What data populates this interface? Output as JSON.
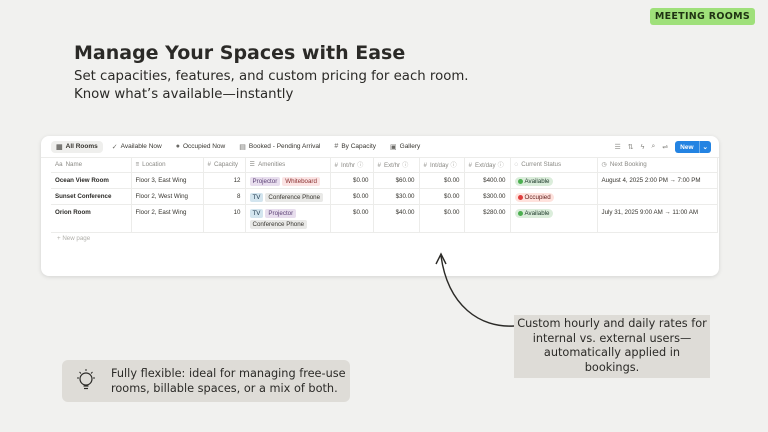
{
  "badge": "MEETING ROOMS",
  "headline": "Manage Your Spaces with Ease",
  "subline1": "Set capacities, features, and custom pricing for each room.",
  "subline2": "Know what’s available—instantly",
  "views": [
    {
      "icon": "table-icon",
      "glyph": "▦",
      "label": "All Rooms"
    },
    {
      "icon": "check-icon",
      "glyph": "✓",
      "label": "Available Now"
    },
    {
      "icon": "circle-icon",
      "glyph": "●",
      "label": "Occupied Now"
    },
    {
      "icon": "calendar-icon",
      "glyph": "▤",
      "label": "Booked - Pending Arrival"
    },
    {
      "icon": "hash-icon",
      "glyph": "#",
      "label": "By Capacity"
    },
    {
      "icon": "gallery-icon",
      "glyph": "▣",
      "label": "Gallery"
    }
  ],
  "toolbar": {
    "new_label": "New"
  },
  "columns": [
    {
      "glyph": "Aa",
      "label": "Name",
      "info": false
    },
    {
      "glyph": "≡",
      "label": "Location",
      "info": false
    },
    {
      "glyph": "#",
      "label": "Capacity",
      "info": false
    },
    {
      "glyph": "☰",
      "label": "Amenities",
      "info": false
    },
    {
      "glyph": "#",
      "label": "Int/hr",
      "info": true
    },
    {
      "glyph": "#",
      "label": "Ext/hr",
      "info": true
    },
    {
      "glyph": "#",
      "label": "Int/day",
      "info": true
    },
    {
      "glyph": "#",
      "label": "Ext/day",
      "info": true
    },
    {
      "glyph": "◌",
      "label": "Current Status",
      "info": false
    },
    {
      "glyph": "◷",
      "label": "Next Booking",
      "info": false
    }
  ],
  "rows": [
    {
      "name": "Ocean View Room",
      "location": "Floor 3, East Wing",
      "capacity": "12",
      "amenities": [
        {
          "label": "Projector",
          "bg": "#e8deee",
          "fg": "#5a3e74"
        },
        {
          "label": "Whiteboard",
          "bg": "#fbe4e4",
          "fg": "#8a2e2e"
        }
      ],
      "int_hr": "$0.00",
      "ext_hr": "$60.00",
      "int_day": "$0.00",
      "ext_day": "$400.00",
      "status": {
        "label": "Available",
        "dot": "#4caf50",
        "bg": "#dbeddb",
        "fg": "#1c3829"
      },
      "next": "August 4, 2025 2:00 PM → 7:00 PM"
    },
    {
      "name": "Sunset Conference",
      "location": "Floor 2, West Wing",
      "capacity": "8",
      "amenities": [
        {
          "label": "TV",
          "bg": "#d3e5ef",
          "fg": "#183347"
        },
        {
          "label": "Conference Phone",
          "bg": "#e9e9e7",
          "fg": "#37352f"
        }
      ],
      "int_hr": "$0.00",
      "ext_hr": "$30.00",
      "int_day": "$0.00",
      "ext_day": "$300.00",
      "status": {
        "label": "Occupied",
        "dot": "#e03e3e",
        "bg": "#ffe2dd",
        "fg": "#5d1715"
      },
      "next": ""
    },
    {
      "name": "Orion Room",
      "location": "Floor 2, East Wing",
      "capacity": "10",
      "amenities": [
        {
          "label": "TV",
          "bg": "#d3e5ef",
          "fg": "#183347"
        },
        {
          "label": "Projector",
          "bg": "#e8deee",
          "fg": "#5a3e74"
        },
        {
          "label": "Conference Phone",
          "bg": "#e9e9e7",
          "fg": "#37352f"
        }
      ],
      "int_hr": "$0.00",
      "ext_hr": "$40.00",
      "int_day": "$0.00",
      "ext_day": "$280.00",
      "status": {
        "label": "Available",
        "dot": "#4caf50",
        "bg": "#dbeddb",
        "fg": "#1c3829"
      },
      "next": "July 31, 2025 9:00 AM → 11:00 AM"
    }
  ],
  "new_page": "+ New page",
  "callout_right": "Custom hourly and daily rates for internal vs. external users—automatically applied in bookings.",
  "callout_left_line1": "Fully flexible: ideal for managing free-use",
  "callout_left_line2": "rooms, billable spaces, or a mix of both.",
  "callout_left_icon": "lightbulb-icon"
}
